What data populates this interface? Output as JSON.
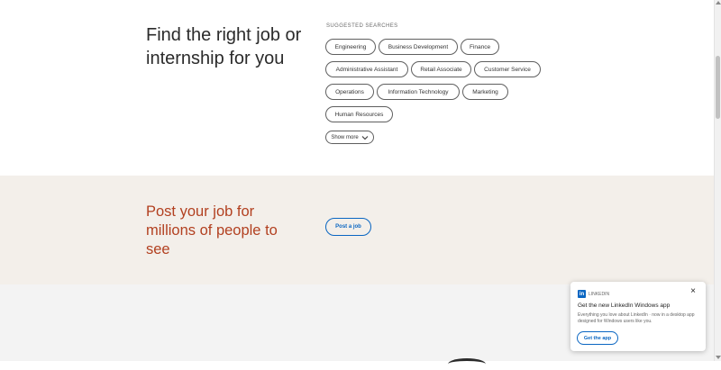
{
  "jobs_section": {
    "headline": "Find the right job or internship for you",
    "suggested_label": "SUGGESTED SEARCHES",
    "pills": [
      "Engineering",
      "Business Development",
      "Finance",
      "Administrative Assistant",
      "Retail Associate",
      "Customer Service",
      "Operations",
      "Information Technology",
      "Marketing",
      "Human Resources"
    ],
    "show_more_label": "Show more"
  },
  "post_section": {
    "headline": "Post your job for millions of people to see",
    "button_label": "Post a job"
  },
  "toast": {
    "brand_text": "LINKEDIN",
    "title": "Get the new LinkedIn Windows app",
    "description": "Everything you love about LinkedIn · now in a desktop app designed for Windows users like you.",
    "button_label": "Get the app",
    "close_glyph": "×"
  },
  "colors": {
    "accent_blue": "#0a66c2",
    "post_headline": "#b24020",
    "post_bg": "#f3efea"
  }
}
